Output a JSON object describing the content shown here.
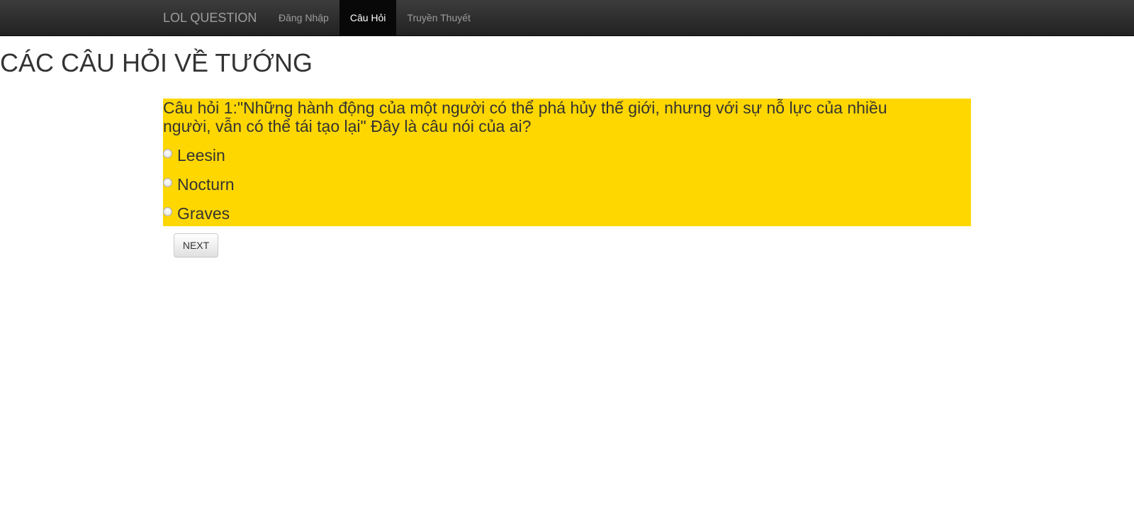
{
  "navbar": {
    "brand": "LOL QUESTION",
    "items": [
      {
        "label": "Đăng Nhập",
        "active": false
      },
      {
        "label": "Câu Hỏi",
        "active": true
      },
      {
        "label": "Truyền Thuyết",
        "active": false
      }
    ]
  },
  "page": {
    "title": "CÁC CÂU HỎI VỀ TƯỚNG"
  },
  "question": {
    "text": "Câu hỏi 1:\"Những hành động của một người có thể phá hủy thế giới, nhưng với sự nỗ lực của nhiều người, vẫn có thể tái tạo lại\" Đây là câu nói của ai?",
    "options": [
      {
        "label": "Leesin",
        "selected": false
      },
      {
        "label": "Nocturn",
        "selected": false
      },
      {
        "label": "Graves",
        "selected": false
      }
    ],
    "background_color": "#ffd700"
  },
  "actions": {
    "next_label": "NEXT"
  }
}
